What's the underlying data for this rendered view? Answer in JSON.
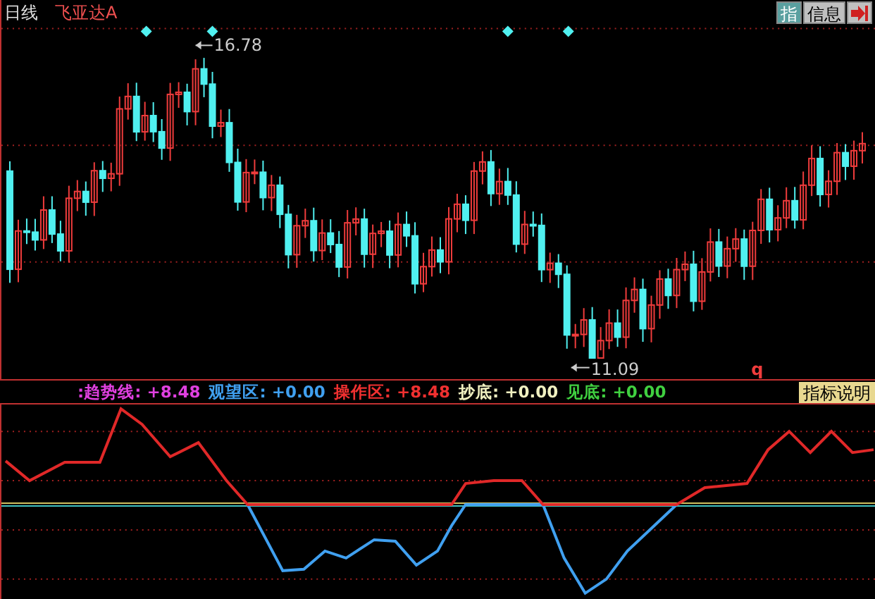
{
  "header": {
    "period": "日线",
    "stock": "飞亚达A",
    "buttons": [
      {
        "label": "指",
        "kind": "indicator"
      },
      {
        "label": "信息",
        "kind": "info"
      }
    ]
  },
  "price_chart": {
    "high_label": "16.78",
    "low_label": "11.09",
    "marker": "q"
  },
  "indicator_bar": {
    "items": [
      {
        "name": ":趋势线",
        "value": ": +8.48",
        "kind": "trend"
      },
      {
        "name": "观望区",
        "value": ": +0.00",
        "kind": "watch"
      },
      {
        "name": "操作区",
        "value": ": +8.48",
        "kind": "operate"
      },
      {
        "name": "抄底",
        "value": ": +0.00",
        "kind": "buy"
      },
      {
        "name": "见底",
        "value": ": +0.00",
        "kind": "bottom"
      }
    ],
    "help_button": "指标说明"
  }
}
